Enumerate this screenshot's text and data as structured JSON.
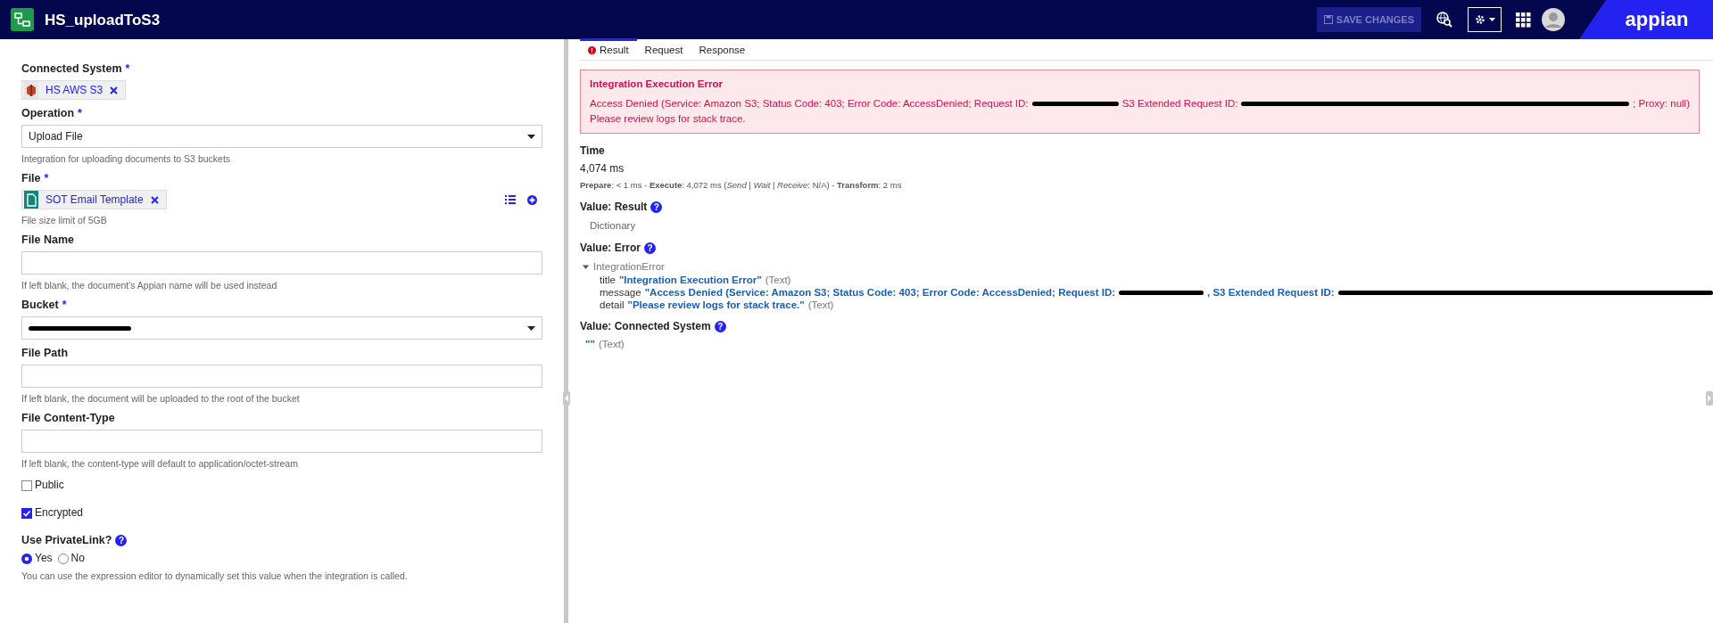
{
  "header": {
    "title": "HS_uploadToS3",
    "save_button": {
      "label": "SAVE CHANGES",
      "disabled": true
    },
    "brand": "appian"
  },
  "form": [
    {
      "kind": "chip",
      "label": "Connected System",
      "required_mark": "*",
      "chip": {
        "kind": "system",
        "label": "HS AWS S3"
      }
    },
    {
      "kind": "select",
      "label": "Operation",
      "required_mark": "*",
      "value": "Upload File",
      "help": "Integration for uploading documents to S3 buckets"
    },
    {
      "kind": "chip",
      "label": "File",
      "required_mark": "*",
      "chip": {
        "kind": "document",
        "label": "SOT Email Template"
      },
      "tools": true,
      "help": "File size limit of 5GB"
    },
    {
      "kind": "text",
      "label": "File Name",
      "help": "If left blank, the document's Appian name will be used instead"
    },
    {
      "kind": "select",
      "label": "Bucket",
      "required_mark": "*",
      "redacted": true
    },
    {
      "kind": "text",
      "label": "File Path",
      "help": "If left blank, the document will be uploaded to the root of the bucket"
    },
    {
      "kind": "text",
      "label": "File Content-Type",
      "help": "If left blank, the content-type will default to application/octet-stream"
    },
    {
      "kind": "checkbox",
      "label": "Public",
      "checked": false
    },
    {
      "kind": "checkbox",
      "label": "Encrypted",
      "checked": true
    },
    {
      "kind": "radio",
      "label": "Use PrivateLink?",
      "help_icon": "?",
      "options": [
        {
          "label": "Yes",
          "selected": true
        },
        {
          "label": "No",
          "selected": false
        }
      ],
      "help": "You can use the expression editor to dynamically set this value when the integration is called."
    }
  ],
  "tabs": [
    {
      "label": "Result",
      "selected": true,
      "error": true
    },
    {
      "label": "Request",
      "selected": false,
      "error": false
    },
    {
      "label": "Response",
      "selected": false,
      "error": false
    }
  ],
  "error_box": {
    "title": "Integration Execution Error",
    "message": [
      {
        "kind": "text",
        "text": "Access Denied (Service: Amazon S3; Status Code: 403; Error Code: AccessDenied; Request ID:"
      },
      {
        "kind": "redacted"
      },
      {
        "kind": "text",
        "text": "S3 Extended Request ID:"
      },
      {
        "kind": "redacted"
      },
      {
        "kind": "text",
        "text": "; Proxy: null)"
      }
    ],
    "detail": "Please review logs for stack trace."
  },
  "time": {
    "label": "Time",
    "value": "4,074 ms",
    "breakdown": "**Prepare**: < 1 ms - **Execute**: 4,072 ms (*Send* | *Wait* | *Receive*: N/A) - **Transform**: 2 ms"
  },
  "values": [
    {
      "kind": "plain",
      "label": "Value: Result",
      "help_icon": "?",
      "text": "Dictionary"
    },
    {
      "kind": "tree",
      "label": "Value: Error",
      "help_icon": "?",
      "node": "IntegrationError",
      "expanded": true,
      "children": [
        {
          "key": "title",
          "parts": [
            {
              "kind": "text",
              "text": "\"Integration Execution Error\""
            }
          ],
          "type": "(Text)"
        },
        {
          "key": "message",
          "parts": [
            {
              "kind": "text",
              "text": "\"Access Denied (Service: Amazon S3; Status Code: 403; Error Code: AccessDenied; Request ID:"
            },
            {
              "kind": "redacted"
            },
            {
              "kind": "text",
              "text": ", S3 Extended Request ID:"
            },
            {
              "kind": "redacted"
            }
          ]
        },
        {
          "key": "detail",
          "parts": [
            {
              "kind": "text",
              "text": "\"Please review logs for stack trace.\""
            }
          ],
          "type": "(Text)"
        }
      ]
    },
    {
      "kind": "typed",
      "label": "Value: Connected System",
      "help_icon": "?",
      "text": "\"\"",
      "type": "(Text)"
    }
  ]
}
